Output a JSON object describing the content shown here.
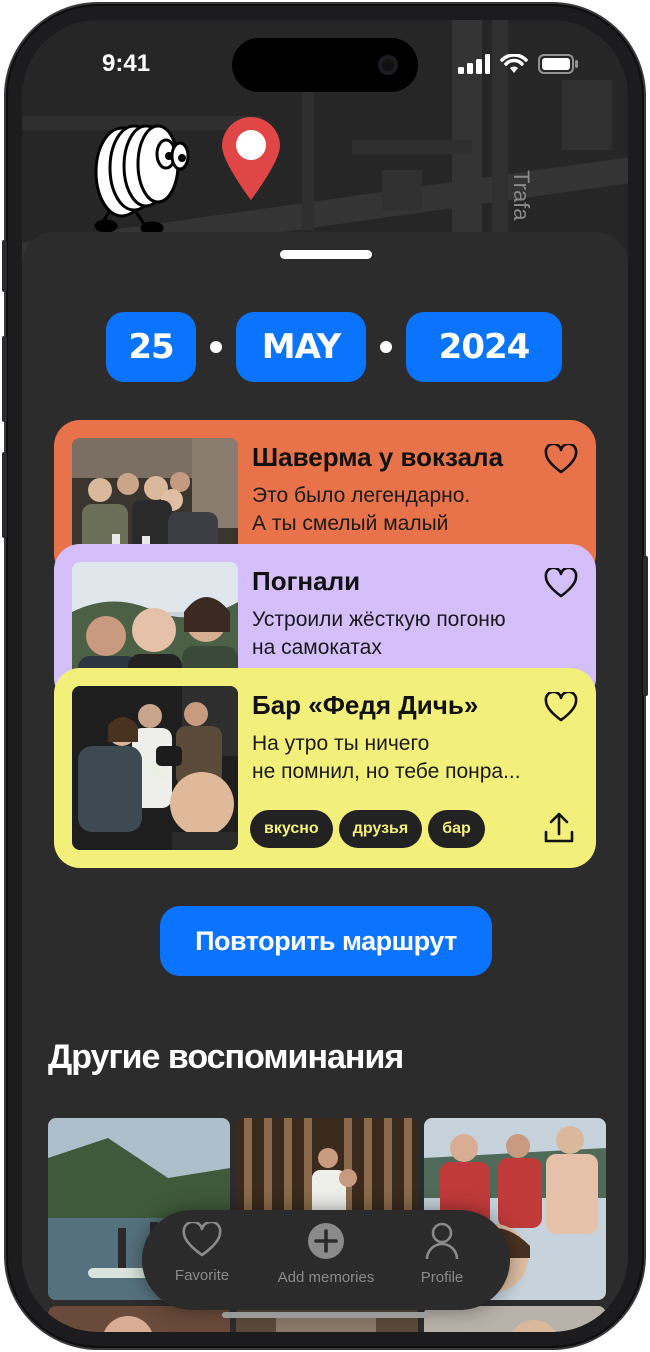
{
  "status_bar": {
    "time": "9:41"
  },
  "map": {
    "street_label": "Trafa"
  },
  "date": {
    "day": "25",
    "month": "MAY",
    "year": "2024"
  },
  "memories": [
    {
      "title": "Шаверма у вокзала",
      "desc_line1": "Это было легендарно.",
      "desc_line2": "А ты смелый малый",
      "color": "#e8734a",
      "favorite": false
    },
    {
      "title": "Погнали",
      "desc_line1": "Устроили жёсткую погоню",
      "desc_line2": "на самокатах",
      "color": "#d5bffb",
      "favorite": false
    },
    {
      "title": "Бар «Федя Дичь»",
      "desc_line1": "На утро ты ничего",
      "desc_line2": "не помнил, но тебе понра...",
      "color": "#f2ef7a",
      "favorite": false,
      "tags": [
        "вкусно",
        "друзья",
        "бар"
      ]
    }
  ],
  "repeat_button": "Повторить маршрут",
  "other_memories_title": "Другие воспоминания",
  "tabbar": {
    "favorite": "Favorite",
    "add": "Add memories",
    "profile": "Profile"
  },
  "colors": {
    "accent": "#0b74ff",
    "sheet_bg": "#2c2c2c",
    "pin": "#e04646"
  },
  "icons": [
    "heart-icon",
    "share-icon",
    "plus-circle-icon",
    "person-icon",
    "map-pin-icon",
    "wifi-icon",
    "battery-icon",
    "signal-icon"
  ]
}
